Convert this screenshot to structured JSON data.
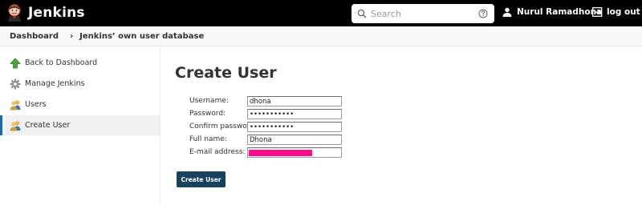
{
  "app": {
    "name": "Jenkins"
  },
  "header": {
    "search_placeholder": "Search",
    "user_name": "Nurul Ramadhona",
    "logout_label": "log out"
  },
  "breadcrumb": [
    {
      "label": "Dashboard"
    },
    {
      "label": "Jenkins’ own user database"
    }
  ],
  "sidebar": {
    "items": [
      {
        "label": "Back to Dashboard",
        "icon": "arrow-up-icon"
      },
      {
        "label": "Manage Jenkins",
        "icon": "gear-icon"
      },
      {
        "label": "Users",
        "icon": "users-icon"
      },
      {
        "label": "Create User",
        "icon": "user-add-icon",
        "active": true
      }
    ]
  },
  "main": {
    "title": "Create User",
    "fields": {
      "username": {
        "label": "Username:",
        "value": "dhona"
      },
      "password": {
        "label": "Password:",
        "value": "dhona123456"
      },
      "confirm_password": {
        "label": "Confirm password:",
        "value": "dhona123456"
      },
      "full_name": {
        "label": "Full name:",
        "value": "Dhona"
      },
      "email": {
        "label": "E-mail address:",
        "value": ""
      }
    },
    "submit_label": "Create User"
  },
  "colors": {
    "header_bg": "#000000",
    "submit_bg": "#16425e",
    "active_border": "#1a6ab0",
    "redaction": "#ff0c8c"
  }
}
